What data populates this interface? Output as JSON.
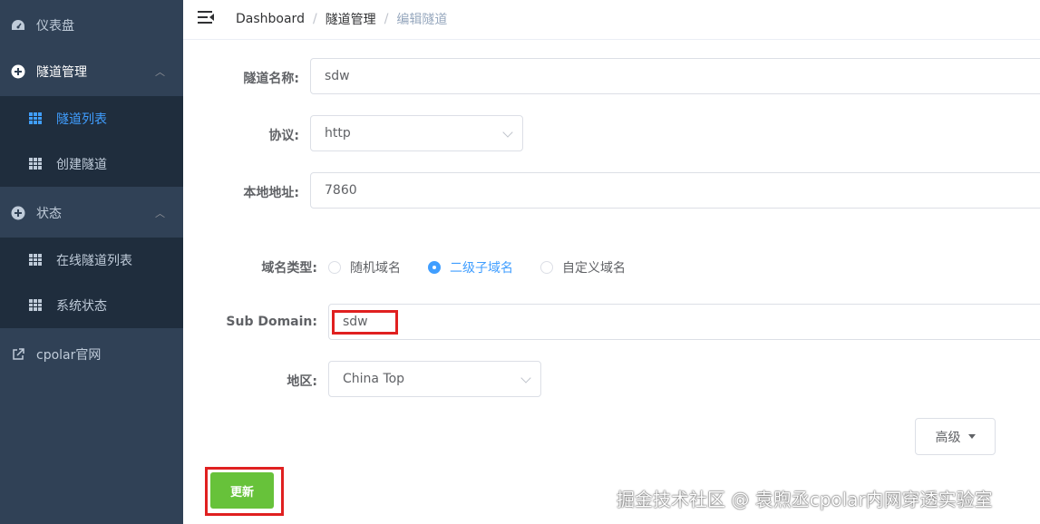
{
  "sidebar": {
    "dashboard": {
      "label": "仪表盘",
      "icon": "dashboard-icon"
    },
    "tunnel_mgmt": {
      "label": "隧道管理",
      "icon": "plus-circle-icon",
      "expanded": true
    },
    "tunnel_list": {
      "label": "隧道列表",
      "icon": "grid-icon",
      "active": true
    },
    "create_tunnel": {
      "label": "创建隧道",
      "icon": "grid-icon"
    },
    "status": {
      "label": "状态",
      "icon": "plus-circle-icon",
      "expanded": true
    },
    "online_tunnels": {
      "label": "在线隧道列表",
      "icon": "grid-icon"
    },
    "system_status": {
      "label": "系统状态",
      "icon": "grid-icon"
    },
    "cpolar_site": {
      "label": "cpolar官网",
      "icon": "external-link-icon"
    }
  },
  "header": {
    "breadcrumb": [
      "Dashboard",
      "隧道管理",
      "编辑隧道"
    ],
    "separator": "/"
  },
  "form": {
    "tunnel_name": {
      "label": "隧道名称:",
      "value": "sdw"
    },
    "protocol": {
      "label": "协议:",
      "value": "http"
    },
    "local_address": {
      "label": "本地地址:",
      "value": "7860"
    },
    "domain_type": {
      "label": "域名类型:",
      "options": [
        "随机域名",
        "二级子域名",
        "自定义域名"
      ],
      "selected": "二级子域名"
    },
    "sub_domain": {
      "label": "Sub Domain:",
      "value": "sdw"
    },
    "region": {
      "label": "地区:",
      "value": "China Top"
    }
  },
  "buttons": {
    "advanced": "高级",
    "update": "更新"
  },
  "watermark": "掘金技术社区 @ 袁煦丞cpolar内网穿透实验室",
  "colors": {
    "sidebar_bg": "#304156",
    "submenu_bg": "#1f2d3d",
    "active": "#409eff",
    "update_button": "#67c23a",
    "highlight_box": "#e02020"
  }
}
